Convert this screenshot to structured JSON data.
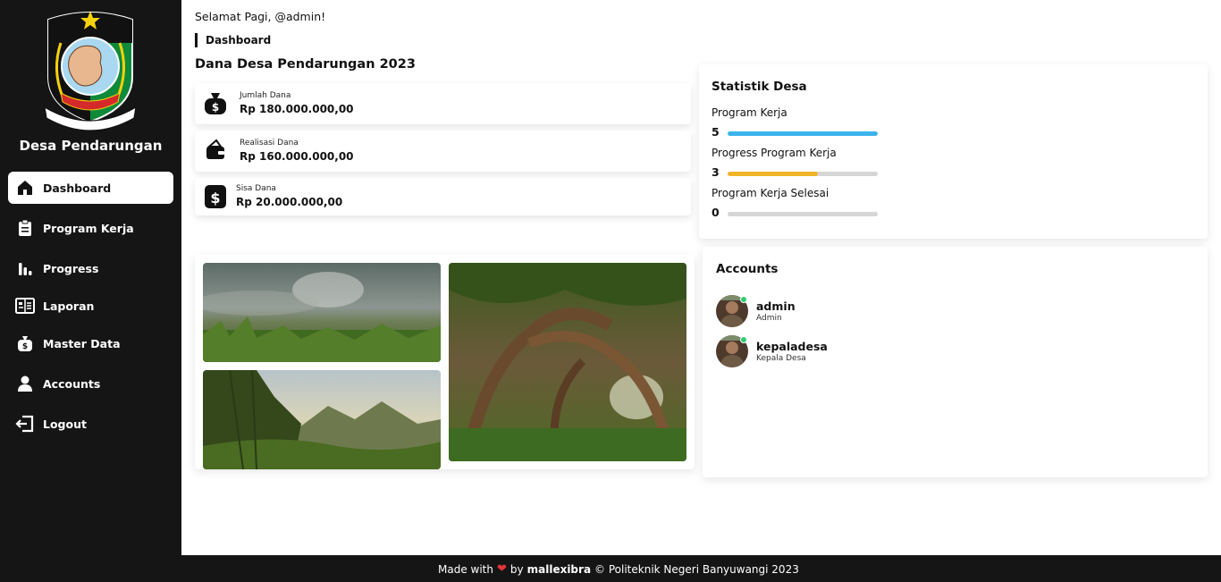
{
  "sidebar": {
    "village_name": "Desa Pendarungan",
    "logo": {
      "banner_text": "BANYUWANGI",
      "motto": "SATYA BHAKTI PRAJA MUKTI"
    },
    "items": [
      {
        "label": "Dashboard",
        "icon": "home-icon",
        "active": true
      },
      {
        "label": "Program Kerja",
        "icon": "clipboard-icon"
      },
      {
        "label": "Progress",
        "icon": "bar-chart-icon"
      },
      {
        "label": "Laporan",
        "icon": "report-icon"
      },
      {
        "label": "Master Data",
        "icon": "money-bag-icon"
      },
      {
        "label": "Accounts",
        "icon": "user-icon"
      },
      {
        "label": "Logout",
        "icon": "logout-icon"
      }
    ]
  },
  "header": {
    "greeting": "Selamat Pagi, @admin!",
    "breadcrumb": "Dashboard"
  },
  "funds": {
    "title": "Dana Desa Pendarungan 2023",
    "cards": [
      {
        "label": "Jumlah Dana",
        "value": "Rp 180.000.000,00",
        "icon": "money-bag-icon"
      },
      {
        "label": "Realisasi Dana",
        "value": "Rp 160.000.000,00",
        "icon": "wallet-icon"
      },
      {
        "label": "Sisa Dana",
        "value": "Rp 20.000.000,00",
        "icon": "dollar-icon"
      }
    ]
  },
  "gallery": {
    "photos": [
      "misty-field-photo",
      "bamboo-hills-photo",
      "tree-tunnel-photo"
    ]
  },
  "stats": {
    "title": "Statistik Desa",
    "rows": [
      {
        "label": "Program Kerja",
        "value": "5",
        "fraction": 1.0,
        "color": "#3bb4ec"
      },
      {
        "label": "Progress Program Kerja",
        "value": "3",
        "fraction": 0.6,
        "color": "#f0b429"
      },
      {
        "label": "Program Kerja Selesai",
        "value": "0",
        "fraction": 0.0,
        "color": "#d6d6d6"
      }
    ]
  },
  "accounts": {
    "title": "Accounts",
    "items": [
      {
        "name": "admin",
        "role": "Admin",
        "online": true
      },
      {
        "name": "kepaladesa",
        "role": "Kepala Desa",
        "online": true
      }
    ]
  },
  "footer": {
    "made_with": "Made with",
    "by": "by",
    "author": "mallexibra",
    "copyright": "© Politeknik Negeri Banyuwangi 2023"
  },
  "colors": {
    "sidebar_bg": "#151515",
    "accent_blue": "#3bb4ec",
    "accent_yellow": "#f0b429",
    "heart": "#e5333a",
    "online": "#2ecc71"
  }
}
